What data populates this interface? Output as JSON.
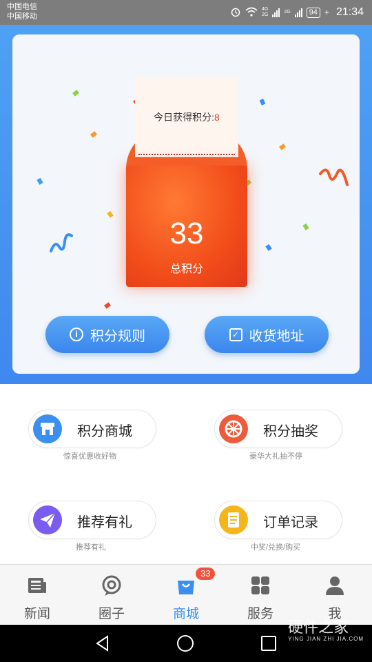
{
  "status": {
    "carrier1": "中国电信",
    "carrier2": "中国移动",
    "net1": "4G",
    "net2": "2G",
    "net3": "2G",
    "battery": "94",
    "time": "21:34"
  },
  "points": {
    "today_label": "今日获得积分:",
    "today_value": "8",
    "total_value": "33",
    "total_label": "总积分",
    "rules_button": "积分规则",
    "address_button": "收货地址"
  },
  "features": [
    {
      "label": "积分商城",
      "sub": "惊喜优惠收好物",
      "icon": "store-icon",
      "color": "#3a8ff0"
    },
    {
      "label": "积分抽奖",
      "sub": "豪华大礼抽不停",
      "icon": "lottery-wheel-icon",
      "color": "#ef5a3a"
    },
    {
      "label": "推荐有礼",
      "sub": "推荐有礼",
      "icon": "paper-plane-icon",
      "color": "#7a5cf0"
    },
    {
      "label": "订单记录",
      "sub": "中奖/兑换/购买",
      "icon": "order-record-icon",
      "color": "#f7b51c"
    }
  ],
  "nav": {
    "items": [
      {
        "label": "新闻",
        "icon": "news-icon"
      },
      {
        "label": "圈子",
        "icon": "circle-chat-icon"
      },
      {
        "label": "商城",
        "icon": "shopping-bag-icon",
        "badge": "33",
        "active": true
      },
      {
        "label": "服务",
        "icon": "services-grid-icon"
      },
      {
        "label": "我",
        "icon": "profile-icon"
      }
    ]
  },
  "watermark": {
    "title": "硬件之家",
    "sub": "YING JIAN ZHI JIA.COM"
  },
  "colors": {
    "primary_blue": "#3f88ef",
    "envelope_red": "#f24d1a",
    "badge_red": "#f4513b"
  }
}
